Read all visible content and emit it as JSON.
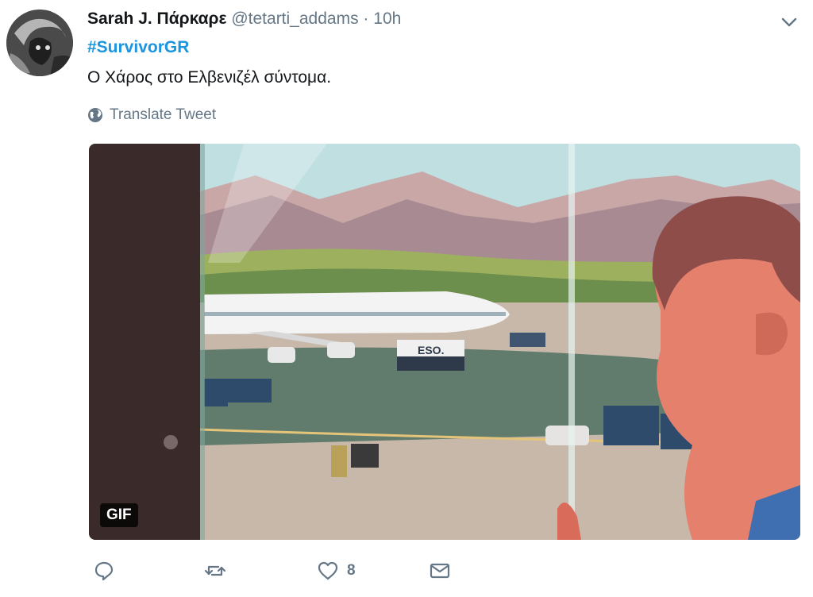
{
  "tweet": {
    "author_name": "Sarah J. Πάρκαρε",
    "author_handle": "@tetarti_addams",
    "separator": "·",
    "time": "10h",
    "hashtag": "#SurvivorGR",
    "text": "Ο Χάρος στο Ελβενιζέλ σύντομα.",
    "translate_label": "Translate Tweet",
    "media_badge": "GIF",
    "truck_label": "ESO.",
    "like_count": "8"
  },
  "icons": {
    "menu": "chevron-down-icon",
    "translate": "globe-icon",
    "reply": "reply-icon",
    "retweet": "retweet-icon",
    "like": "heart-icon",
    "message": "envelope-icon"
  },
  "colors": {
    "link": "#1b95e0",
    "secondary_text": "#657786",
    "primary_text": "#14171a"
  }
}
